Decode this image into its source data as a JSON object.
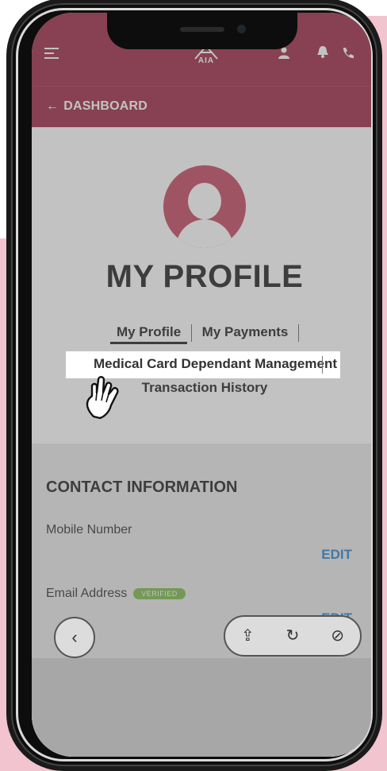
{
  "header": {
    "logo_text": "AIA",
    "back_label": "DASHBOARD",
    "back_arrow": "←"
  },
  "icons": {
    "menu": "menu-icon",
    "user": "user-icon",
    "bell": "bell-icon",
    "phone": "phone-icon",
    "hand": "hand-pointer-icon"
  },
  "profile": {
    "title": "MY PROFILE"
  },
  "tabs": [
    {
      "label": "My Profile",
      "active": true
    },
    {
      "label": "My Payments",
      "active": false
    },
    {
      "label": "Medical Card Dependant Management",
      "active": false
    },
    {
      "label": "Transaction History",
      "active": false
    }
  ],
  "contact": {
    "section_title": "CONTACT INFORMATION",
    "mobile_label": "Mobile Number",
    "mobile_edit": "EDIT",
    "email_label": "Email Address",
    "email_badge": "VERIFIED",
    "email_edit": "EDIT"
  },
  "browser": {
    "back_glyph": "‹",
    "share_glyph": "⇪",
    "reload_glyph": "↻",
    "compass_glyph": "⊘"
  },
  "colors": {
    "brand": "#a53a54",
    "avatar": "#c9566f",
    "verified": "#86c05a",
    "edit_link": "#3a8fd0",
    "backdrop_pink": "#f1c4cf"
  }
}
